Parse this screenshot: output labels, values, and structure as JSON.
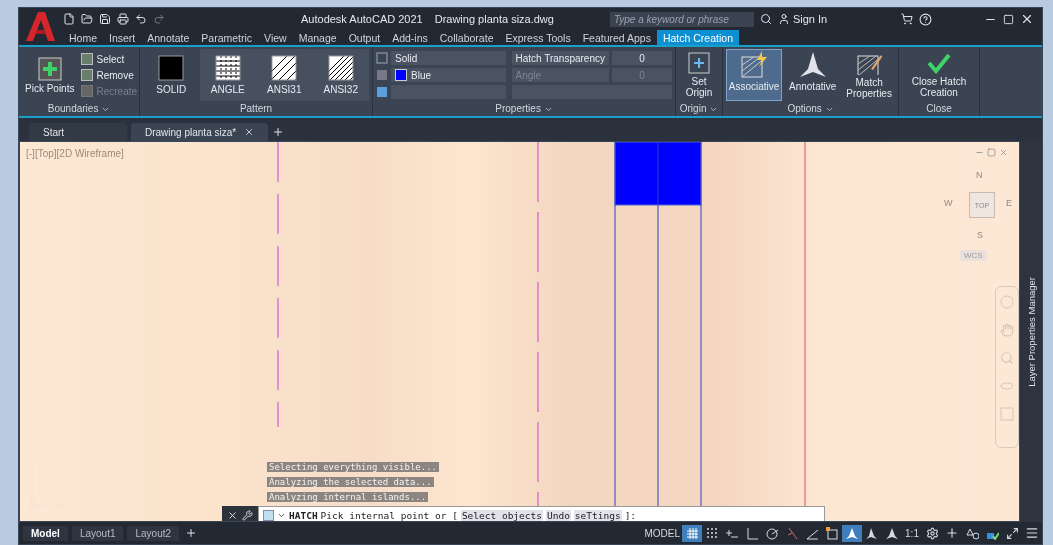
{
  "title_bar": {
    "title": "Autodesk AutoCAD 2021",
    "file": "Drawing planta siza.dwg",
    "search": {
      "placeholder": "Type a keyword or phrase"
    },
    "sign_in": "Sign In"
  },
  "ribbon_tabs": [
    {
      "label": "Home",
      "selected": false
    },
    {
      "label": "Insert",
      "selected": false
    },
    {
      "label": "Annotate",
      "selected": false
    },
    {
      "label": "Parametric",
      "selected": false
    },
    {
      "label": "View",
      "selected": false
    },
    {
      "label": "Manage",
      "selected": false
    },
    {
      "label": "Output",
      "selected": false
    },
    {
      "label": "Add-ins",
      "selected": false
    },
    {
      "label": "Collaborate",
      "selected": false
    },
    {
      "label": "Express Tools",
      "selected": false
    },
    {
      "label": "Featured Apps",
      "selected": false
    },
    {
      "label": "Hatch Creation",
      "selected": true
    }
  ],
  "boundaries": {
    "title": "Boundaries",
    "pick": "Pick Points",
    "items": [
      {
        "label": "Select",
        "disabled": false
      },
      {
        "label": "Remove",
        "disabled": false
      },
      {
        "label": "Recreate",
        "disabled": true
      }
    ]
  },
  "pattern": {
    "title": "Pattern",
    "items": [
      {
        "label": "SOLID",
        "kind": "solid",
        "selected": true
      },
      {
        "label": "ANGLE",
        "kind": "grid",
        "selected": false
      },
      {
        "label": "ANSI31",
        "kind": "lines",
        "selected": false
      },
      {
        "label": "ANSI32",
        "kind": "double",
        "selected": false
      }
    ]
  },
  "properties": {
    "title": "Properties",
    "type": "Solid",
    "color_name": "Blue",
    "color": "#0000ff",
    "transparency_label": "Hatch Transparency",
    "transparency": "0",
    "angle_label": "Angle",
    "angle": "0",
    "angle_disabled": true
  },
  "origin": {
    "title": "Origin",
    "button": "Set Origin"
  },
  "options": {
    "title": "Options",
    "items": [
      {
        "label": "Associative",
        "kind": "assoc",
        "selected": true
      },
      {
        "label": "Annotative",
        "kind": "annot",
        "selected": false
      },
      {
        "label": "Match Properties",
        "kind": "match",
        "selected": false
      }
    ]
  },
  "close": {
    "title": "Close",
    "button": "Close Hatch Creation"
  },
  "doc_tabs": [
    {
      "label": "Start",
      "selected": false
    },
    {
      "label": "Drawing planta siza*",
      "selected": true
    }
  ],
  "viewport_label": "[-][Top][2D Wireframe]",
  "viewcube": {
    "n": "N",
    "w": "W",
    "top": "TOP",
    "e": "E",
    "s": "S",
    "wcs": "WCS"
  },
  "side_panel": "Layer Properties Manager",
  "command": {
    "messages": [
      "Selecting everything visible...",
      "Analyzing the selected data...",
      "Analyzing internal islands..."
    ],
    "name": "HATCH",
    "prompt": "Pick internal point or [",
    "options": [
      "Select objects",
      "Undo",
      "seTtings"
    ],
    "suffix": "]:"
  },
  "layout_tabs": [
    {
      "label": "Model",
      "selected": true
    },
    {
      "label": "Layout1",
      "selected": false
    },
    {
      "label": "Layout2",
      "selected": false
    }
  ],
  "status_items": [
    {
      "kind": "text",
      "label": "MODEL",
      "on": false
    },
    {
      "kind": "grid",
      "on": true
    },
    {
      "kind": "snap",
      "on": false
    },
    {
      "kind": "infer",
      "on": false
    },
    {
      "kind": "ortho",
      "on": false
    },
    {
      "kind": "polar",
      "on": false
    },
    {
      "kind": "iso",
      "on": false
    },
    {
      "kind": "osnap",
      "on": false
    },
    {
      "kind": "object",
      "on": false
    },
    {
      "kind": "annovis",
      "on": true
    },
    {
      "kind": "autoscale",
      "on": false
    },
    {
      "kind": "annot",
      "on": false
    },
    {
      "kind": "text",
      "label": "1:1",
      "on": false
    },
    {
      "kind": "gear",
      "on": false
    },
    {
      "kind": "plus",
      "on": false
    },
    {
      "kind": "isolate",
      "on": false
    },
    {
      "kind": "hw",
      "on": false
    },
    {
      "kind": "clean",
      "on": false
    },
    {
      "kind": "menu",
      "on": false
    }
  ]
}
